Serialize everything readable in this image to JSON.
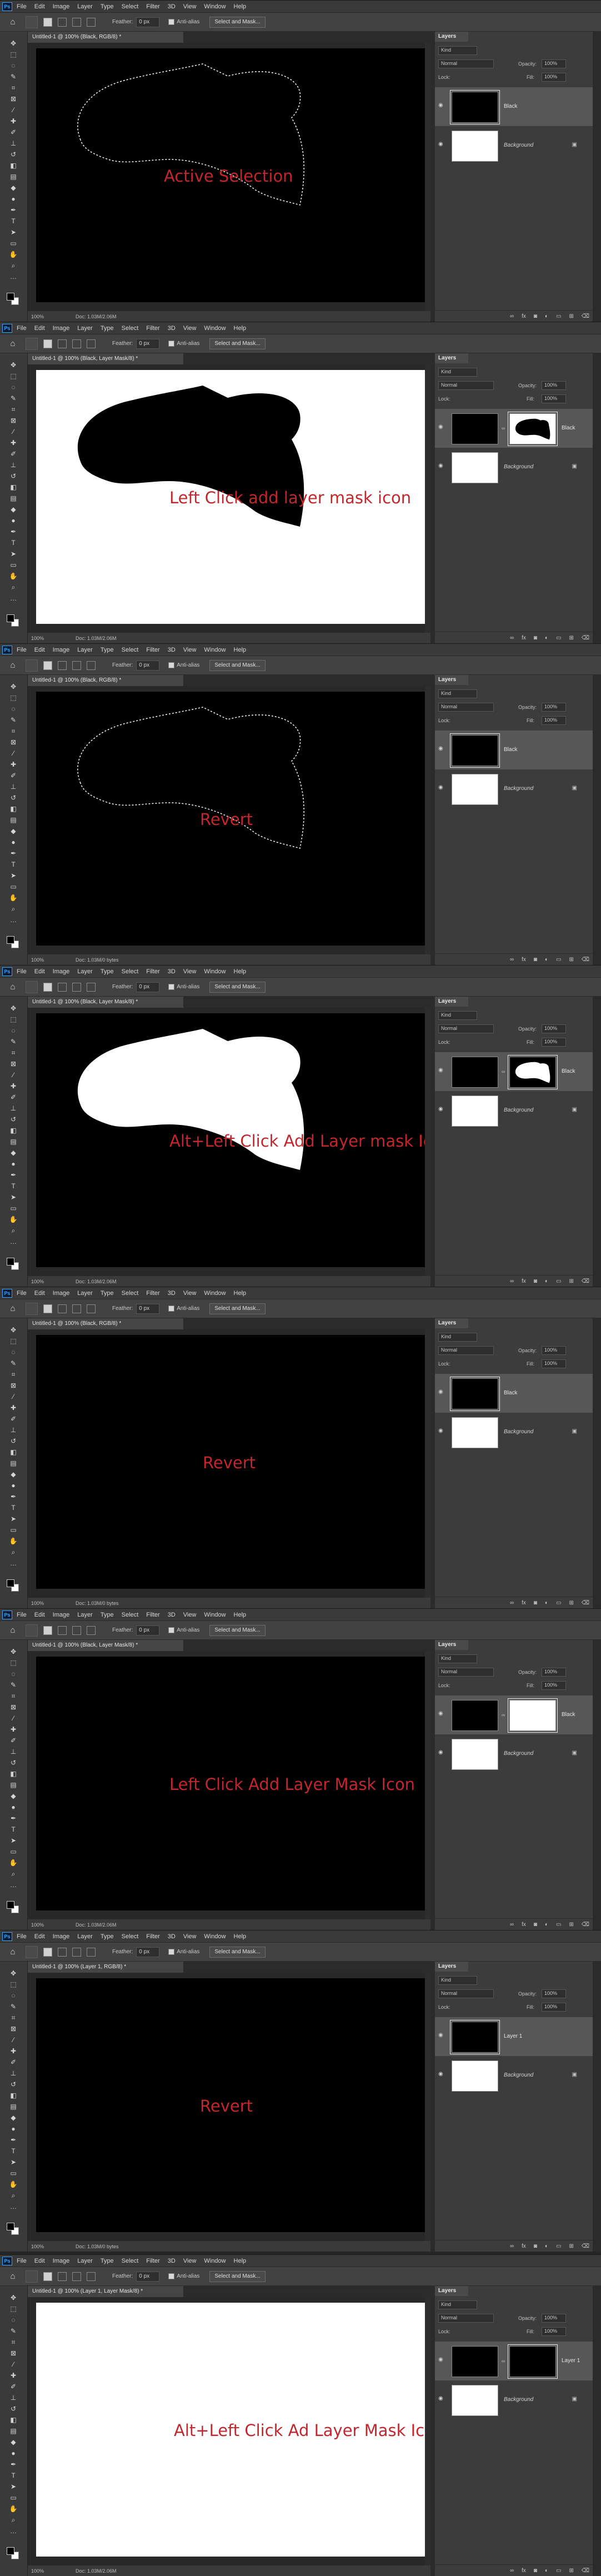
{
  "app": {
    "logo": "Ps",
    "menu": [
      "File",
      "Edit",
      "Image",
      "Layer",
      "Type",
      "Select",
      "Filter",
      "3D",
      "View",
      "Window",
      "Help"
    ]
  },
  "options": {
    "feather_label": "Feather:",
    "feather_value": "0 px",
    "antialias_label": "Anti-alias",
    "select_mask_label": "Select and Mask..."
  },
  "layers_panel": {
    "tab_label": "Layers",
    "kind_label": "Kind",
    "blend_mode": "Normal",
    "opacity_label": "Opacity:",
    "opacity_value": "100%",
    "lock_label": "Lock:",
    "fill_label": "Fill:",
    "fill_value": "100%"
  },
  "frames": [
    {
      "tab_title": "Untitled-1 @ 100% (Black, RGB/8) *",
      "canvas_bg": "#000000",
      "shape": "selection",
      "caption": "Active Selection",
      "zoom": "100%",
      "doc_info": "Doc: 1.03M/2.06M",
      "layers": [
        {
          "name": "Black",
          "thumb": "black",
          "mask": "none",
          "active": true
        },
        {
          "name": "Background",
          "thumb": "white",
          "mask": "none",
          "active": false,
          "locked": true
        }
      ]
    },
    {
      "tab_title": "Untitled-1 @ 100% (Black, Layer Mask/8) *",
      "canvas_bg": "#ffffff",
      "shape": "black",
      "caption": "Left Click add layer mask icon",
      "zoom": "100%",
      "doc_info": "Doc: 1.03M/2.06M",
      "layers": [
        {
          "name": "Black",
          "thumb": "black",
          "mask": "white-shape",
          "active": true
        },
        {
          "name": "Background",
          "thumb": "white",
          "mask": "none",
          "active": false,
          "locked": true
        }
      ]
    },
    {
      "tab_title": "Untitled-1 @ 100% (Black, RGB/8) *",
      "canvas_bg": "#000000",
      "shape": "selection",
      "caption": "Revert",
      "zoom": "100%",
      "doc_info": "Doc: 1.03M/0 bytes",
      "layers": [
        {
          "name": "Black",
          "thumb": "black",
          "mask": "none",
          "active": true
        },
        {
          "name": "Background",
          "thumb": "white",
          "mask": "none",
          "active": false,
          "locked": true
        }
      ]
    },
    {
      "tab_title": "Untitled-1 @ 100% (Black, Layer Mask/8) *",
      "canvas_bg": "#000000",
      "shape": "white",
      "caption": "Alt+Left Click Add Layer mask Icon",
      "zoom": "100%",
      "doc_info": "Doc: 1.03M/2.06M",
      "layers": [
        {
          "name": "Black",
          "thumb": "black",
          "mask": "black-shape",
          "active": true
        },
        {
          "name": "Background",
          "thumb": "white",
          "mask": "none",
          "active": false,
          "locked": true
        }
      ]
    },
    {
      "tab_title": "Untitled-1 @ 100% (Black, RGB/8) *",
      "canvas_bg": "#000000",
      "shape": "none",
      "caption": "Revert",
      "zoom": "100%",
      "doc_info": "Doc: 1.03M/0 bytes",
      "layers": [
        {
          "name": "Black",
          "thumb": "black",
          "mask": "none",
          "active": true
        },
        {
          "name": "Background",
          "thumb": "white",
          "mask": "none",
          "active": false,
          "locked": true
        }
      ]
    },
    {
      "tab_title": "Untitled-1 @ 100% (Black, Layer Mask/8) *",
      "canvas_bg": "#000000",
      "shape": "none",
      "caption": "Left Click Add Layer Mask Icon",
      "zoom": "100%",
      "doc_info": "Doc: 1.03M/2.06M",
      "layers": [
        {
          "name": "Black",
          "thumb": "black",
          "mask": "white",
          "active": true
        },
        {
          "name": "Background",
          "thumb": "white",
          "mask": "none",
          "active": false,
          "locked": true
        }
      ]
    },
    {
      "tab_title": "Untitled-1 @ 100% (Layer 1, RGB/8) *",
      "canvas_bg": "#000000",
      "shape": "none",
      "caption": "Revert",
      "zoom": "100%",
      "doc_info": "Doc: 1.03M/0 bytes",
      "layers": [
        {
          "name": "Layer 1",
          "thumb": "black",
          "mask": "none",
          "active": true
        },
        {
          "name": "Background",
          "thumb": "white",
          "mask": "none",
          "active": false,
          "locked": true
        }
      ]
    },
    {
      "tab_title": "Untitled-1 @ 100% (Layer 1, Layer Mask/8) *",
      "canvas_bg": "#ffffff",
      "shape": "none",
      "caption": "Alt+Left Click Ad Layer Mask Icon",
      "zoom": "100%",
      "doc_info": "Doc: 1.03M/2.06M",
      "layers": [
        {
          "name": "Layer 1",
          "thumb": "black",
          "mask": "black",
          "active": true
        },
        {
          "name": "Background",
          "thumb": "white",
          "mask": "none",
          "active": false,
          "locked": true
        }
      ]
    }
  ]
}
